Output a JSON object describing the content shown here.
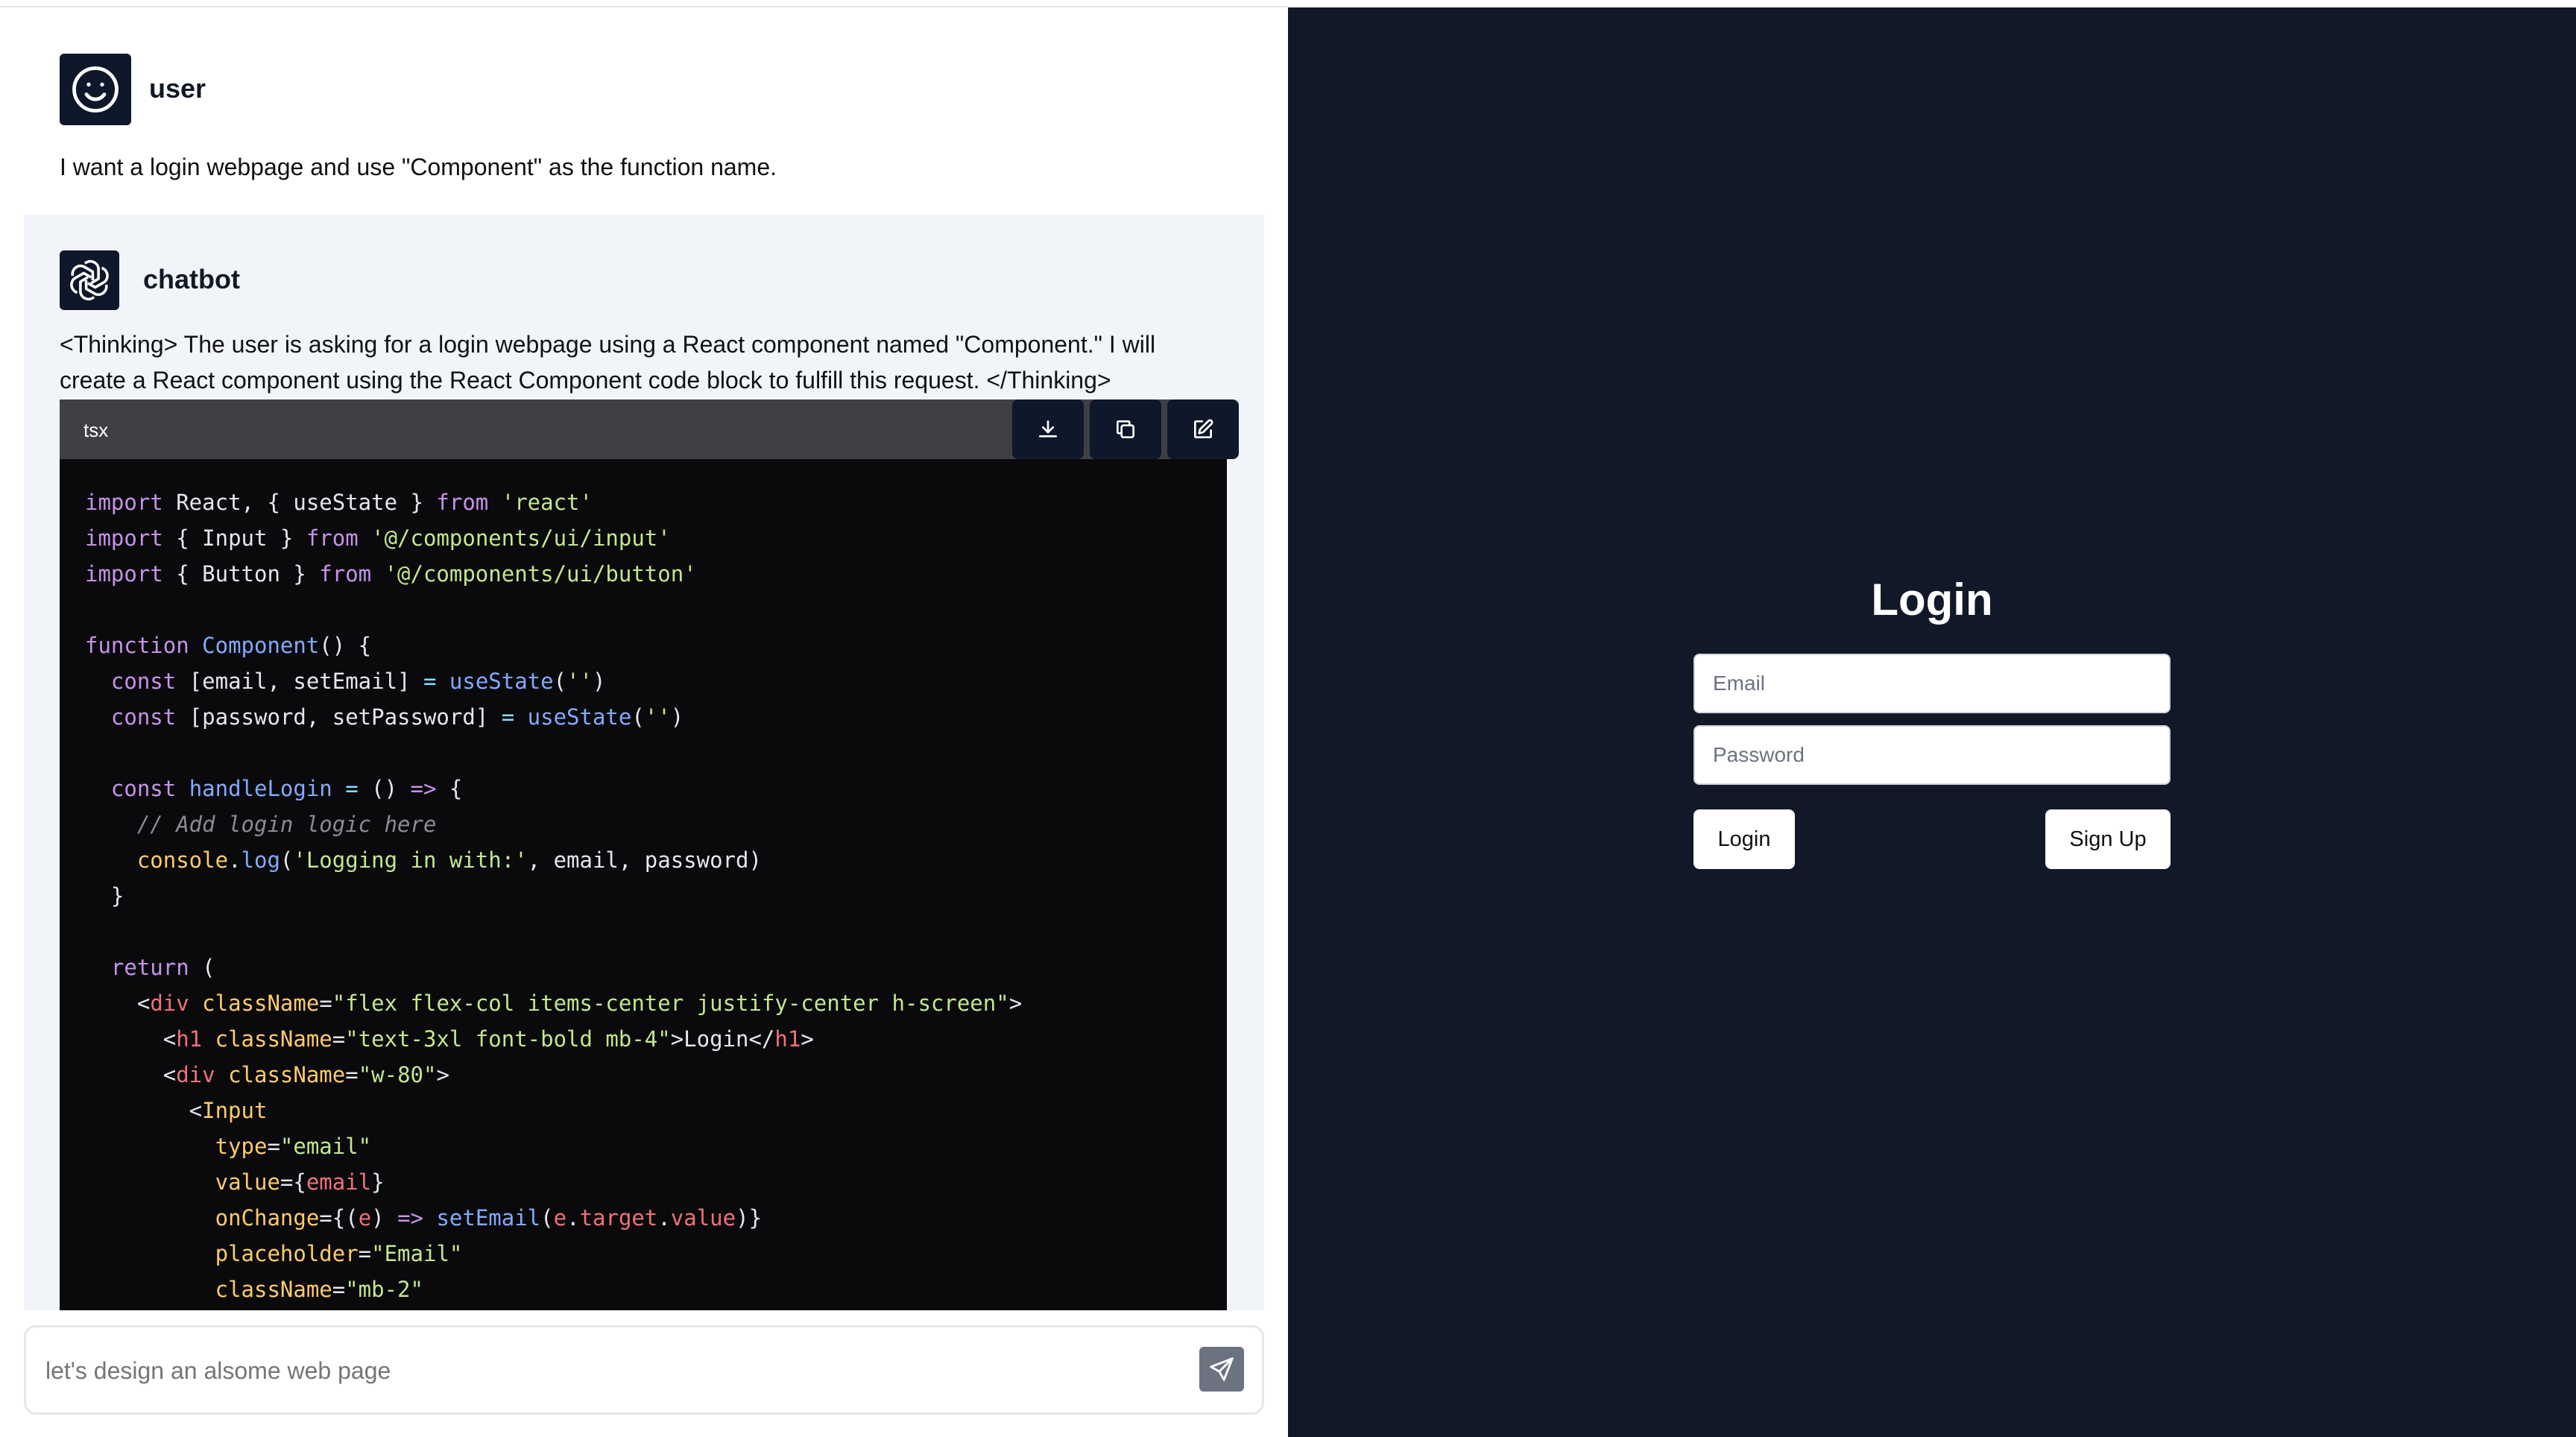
{
  "chat": {
    "user": {
      "name": "user",
      "message": "I want a login webpage and use \"Component\" as the function name."
    },
    "bot": {
      "name": "chatbot",
      "message": "<Thinking> The user is asking for a login webpage using a React component named \"Component.\" I will create a React component using the React Component code block to fulfill this request. </Thinking>",
      "code_language": "tsx",
      "code_buttons": [
        "download-icon",
        "copy-icon",
        "edit-icon"
      ]
    },
    "input": {
      "placeholder": "let's design an alsome web page",
      "value": ""
    }
  },
  "preview": {
    "title": "Login",
    "email_placeholder": "Email",
    "password_placeholder": "Password",
    "login_button": "Login",
    "signup_button": "Sign Up"
  },
  "colors": {
    "preview_background": "#111827",
    "avatar_background": "#0f172a",
    "code_background": "#0a0a0c",
    "code_header": "#3f3f46",
    "bot_message_background": "#f1f5f9"
  }
}
